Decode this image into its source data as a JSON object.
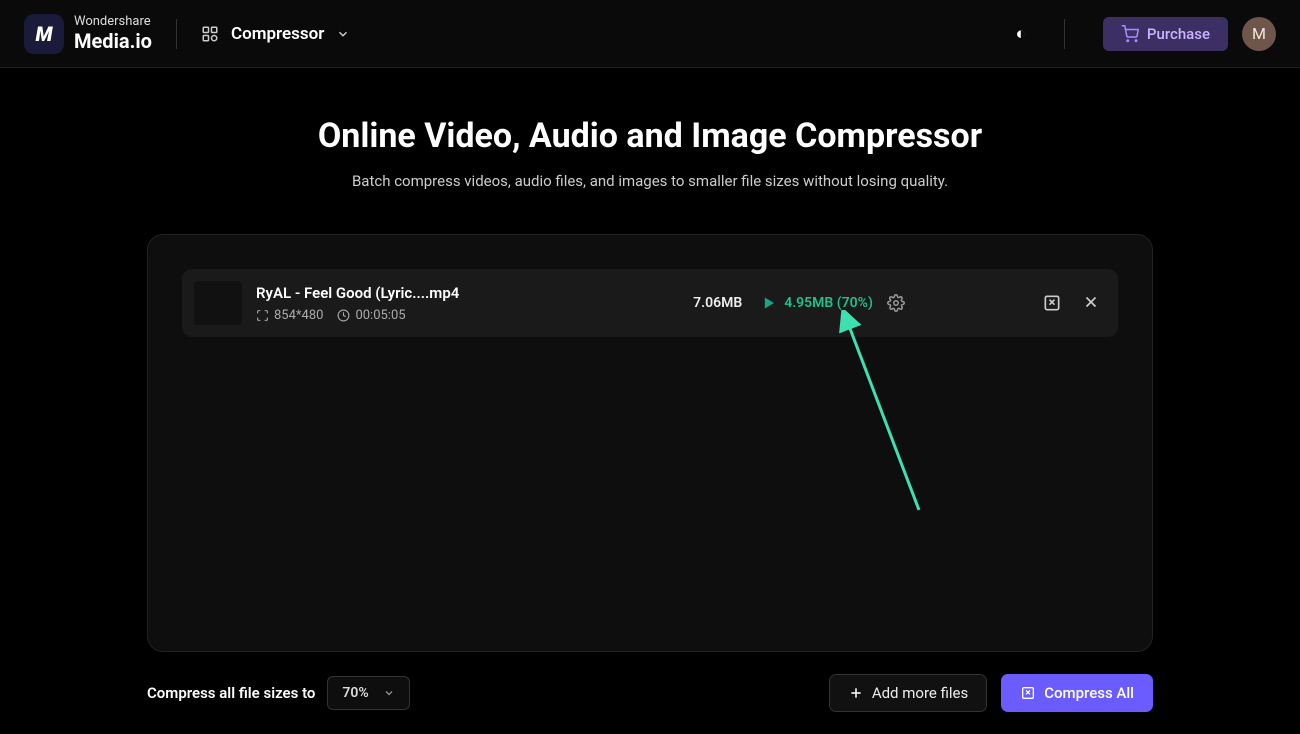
{
  "header": {
    "logo_line1": "Wondershare",
    "logo_line2": "Media.io",
    "tool_label": "Compressor",
    "purchase_label": "Purchase",
    "avatar_initial": "M"
  },
  "main": {
    "title": "Online Video, Audio and Image Compressor",
    "subtitle": "Batch compress videos, audio files, and images to smaller file sizes without losing quality."
  },
  "file": {
    "name": "RyAL - Feel Good (Lyric....mp4",
    "resolution": "854*480",
    "duration": "00:05:05",
    "size_before": "7.06MB",
    "size_after": "4.95MB (70%)"
  },
  "bottom": {
    "compress_label": "Compress all file sizes to",
    "percent_value": "70%",
    "add_more_label": "Add more files",
    "compress_all_label": "Compress All"
  }
}
